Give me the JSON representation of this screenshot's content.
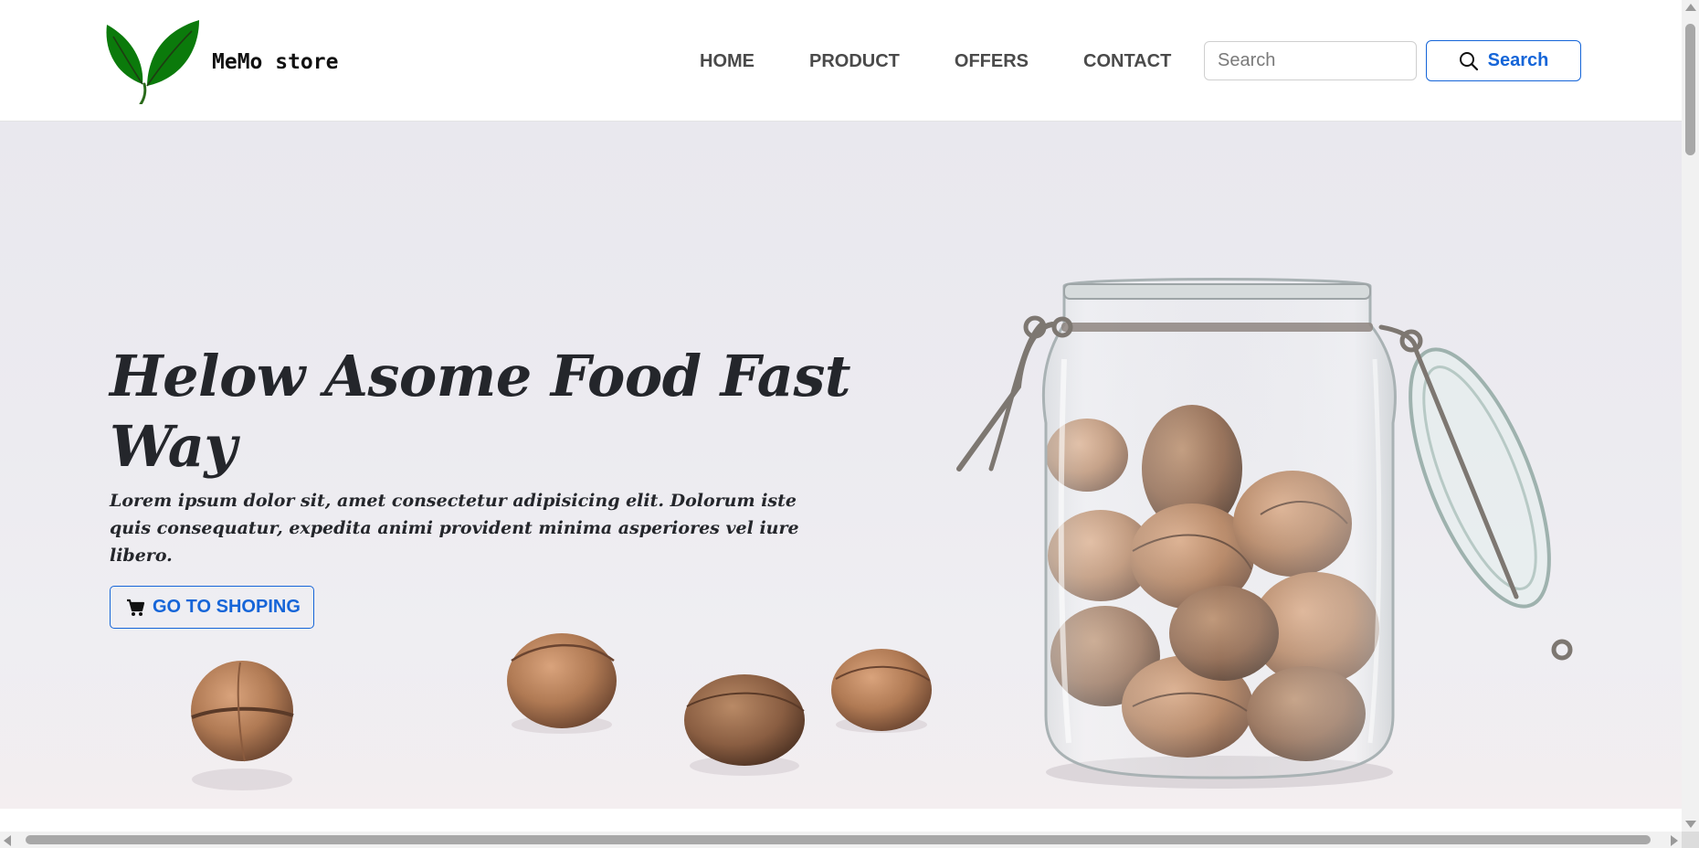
{
  "brand": {
    "name": "MeMo store",
    "logo_icon": "leaf-icon",
    "logo_color": "#0b7a0b"
  },
  "nav": {
    "items": [
      {
        "label": "HOME"
      },
      {
        "label": "PRODUCT"
      },
      {
        "label": "OFFERS"
      },
      {
        "label": "CONTACT"
      }
    ]
  },
  "search": {
    "placeholder": "Search",
    "value": "",
    "button_label": "Search",
    "button_icon": "search-icon"
  },
  "hero": {
    "title": "Helow Asome Food Fast Way",
    "text": "Lorem ipsum dolor sit, amet consectetur adipisicing elit. Dolorum iste quis consequatur, expedita animi provident minima asperiores vel iure libero.",
    "cta_label": "GO TO SHOPING",
    "cta_icon": "cart-icon",
    "image_subject": "walnuts-in-glass-jar"
  },
  "colors": {
    "accent": "#1565d8",
    "text_dark": "#24262b",
    "nav_text": "#4a4a4a"
  }
}
